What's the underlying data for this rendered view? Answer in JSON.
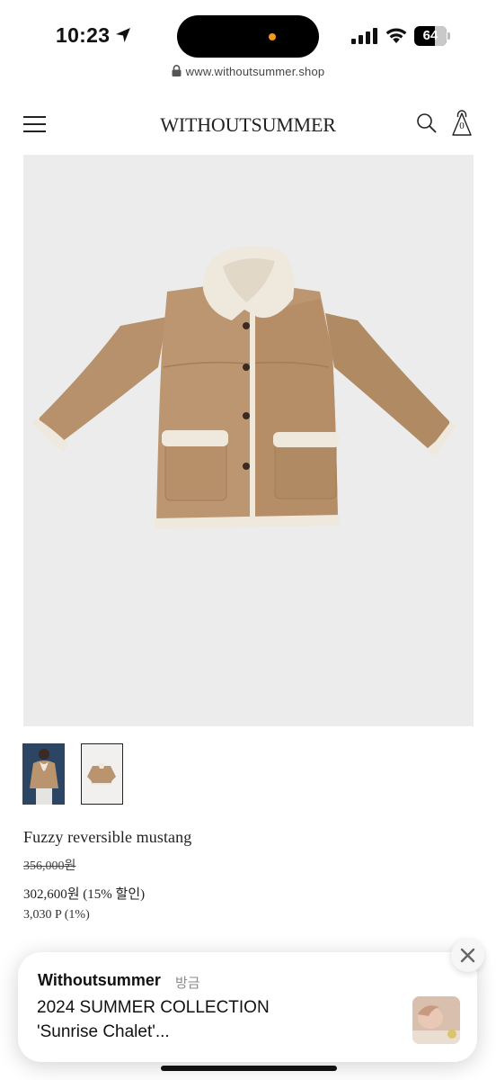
{
  "status_bar": {
    "time": "10:23",
    "battery": "64"
  },
  "browser": {
    "url": "www.withoutsummer.shop"
  },
  "header": {
    "logo": "WITHOUTSUMMER",
    "cart_count": "0"
  },
  "product": {
    "name": "Fuzzy reversible mustang",
    "original_price": "356,000원",
    "sale_price": "302,600원 (15% 할인)",
    "points": "3,030 P (1%)",
    "thumbnails": [
      "model-photo",
      "coat-photo"
    ],
    "colors": {
      "suede": "#b9946e",
      "shearling": "#efe8dc"
    }
  },
  "notification": {
    "app": "Withoutsummer",
    "time": "방금",
    "title": "2024 SUMMER COLLECTION",
    "body": "'Sunrise Chalet'..."
  }
}
